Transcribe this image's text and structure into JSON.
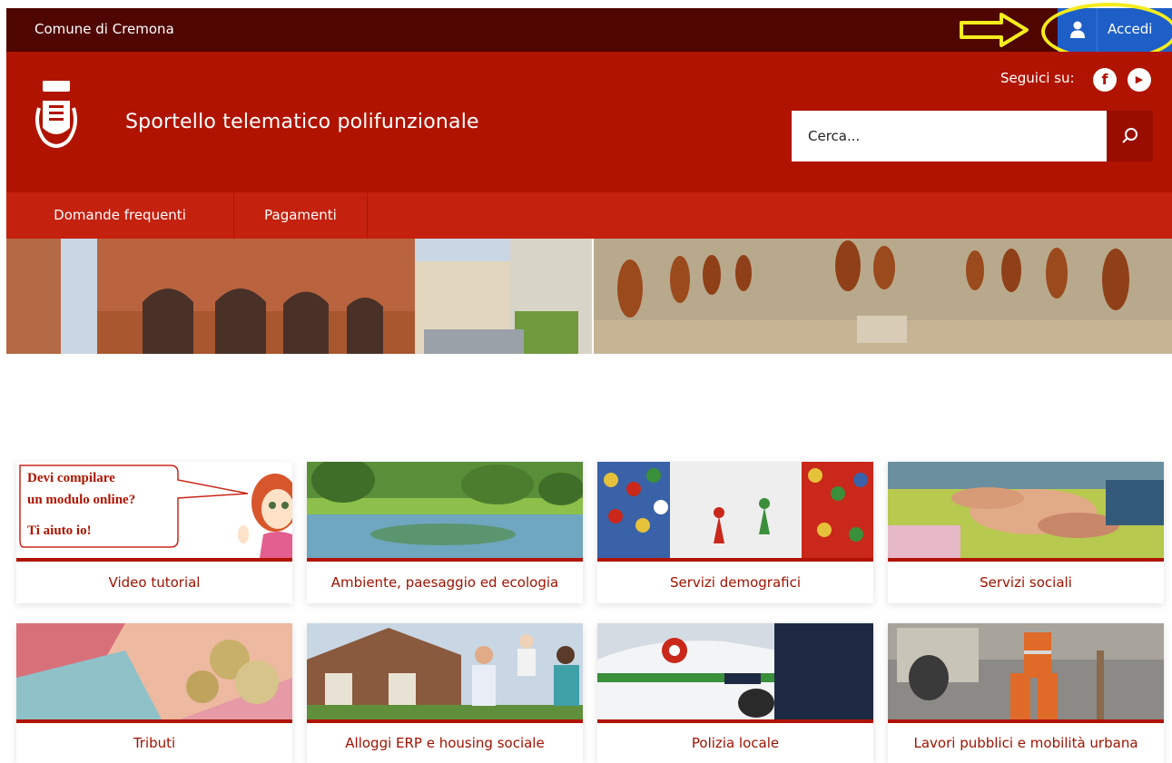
{
  "topbar": {
    "org_name": "Comune di Cremona",
    "login_label": "Accedi"
  },
  "header": {
    "site_title": "Sportello telematico polifunzionale",
    "follow_label": "Seguici su:",
    "social": [
      {
        "icon": "facebook-icon",
        "glyph": "f"
      },
      {
        "icon": "youtube-icon",
        "glyph": "▶"
      }
    ],
    "search": {
      "placeholder": "Cerca...",
      "icon": "search-icon"
    }
  },
  "nav": {
    "items": [
      {
        "label": "Domande frequenti"
      },
      {
        "label": "Pagamenti"
      }
    ]
  },
  "tiles": [
    {
      "label": "Video tutorial",
      "image_text": [
        "Devi compilare",
        "un modulo online?",
        "Ti aiuto io!"
      ]
    },
    {
      "label": "Ambiente, paesaggio ed ecologia"
    },
    {
      "label": "Servizi demografici"
    },
    {
      "label": "Servizi sociali"
    },
    {
      "label": "Tributi"
    },
    {
      "label": "Alloggi ERP e housing sociale"
    },
    {
      "label": "Polizia locale"
    },
    {
      "label": "Lavori pubblici e mobilità urbana"
    }
  ],
  "colors": {
    "topbar": "#4f0500",
    "header": "#b01400",
    "nav": "#c4210f",
    "login_button": "#1e5fc7",
    "annotation": "#f5ec1c",
    "tile_label": "#a01200"
  }
}
